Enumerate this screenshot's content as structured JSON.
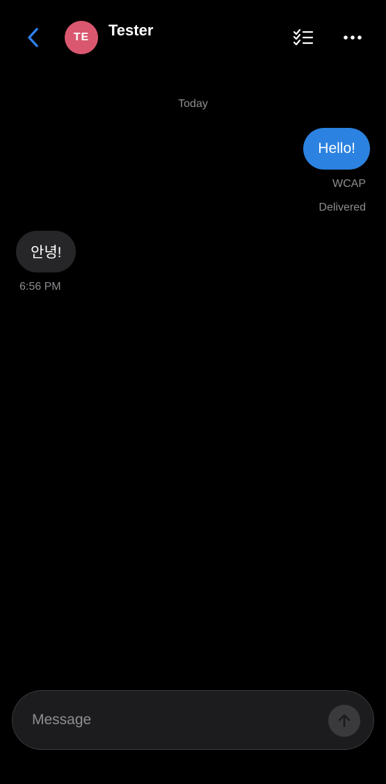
{
  "header": {
    "contact_initials": "TE",
    "contact_name": "Tester",
    "back_icon": "chevron-left-icon",
    "checklist_icon": "checklist-icon",
    "more_icon": "more-horizontal-icon"
  },
  "conversation": {
    "date_separator": "Today",
    "messages": [
      {
        "direction": "outgoing",
        "text": "Hello!",
        "sender_tag": "WCAP",
        "status": "Delivered"
      },
      {
        "direction": "incoming",
        "text": "안녕!",
        "time": "6:56 PM"
      }
    ]
  },
  "composer": {
    "placeholder": "Message",
    "value": "",
    "send_icon": "arrow-up-icon"
  },
  "colors": {
    "background": "#000000",
    "accent": "#2f80ed",
    "avatar": "#d9586f",
    "outgoing_bubble": "#2c82e0",
    "incoming_bubble": "#262628",
    "secondary_text": "#8e8e93",
    "composer_bg": "#1c1c1e",
    "send_button_bg": "#3a3a3c"
  }
}
